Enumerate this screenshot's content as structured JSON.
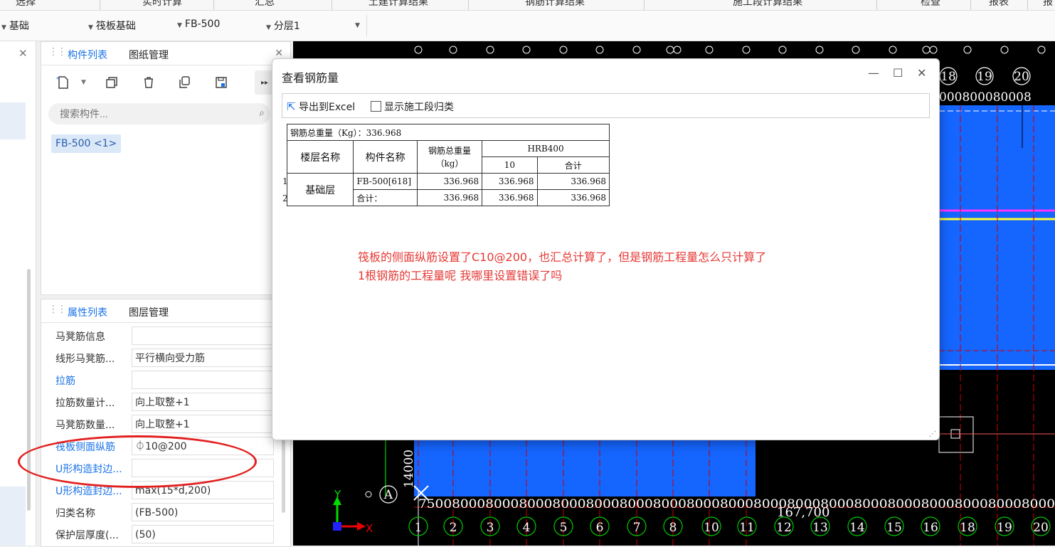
{
  "ribbon": {
    "items": [
      "选择",
      "实时计算",
      "汇总",
      "土建计算结果",
      "钢筋计算结果",
      "施工段计算结果",
      "检查",
      "报表",
      "报"
    ]
  },
  "selectors": {
    "s1": "基础",
    "s2": "筏板基础",
    "s3": "FB-500",
    "s4": "分层1"
  },
  "panel1": {
    "tab_active": "构件列表",
    "tab_other": "图纸管理",
    "search_placeholder": "搜索构件...",
    "component_item": "FB-500 <1>"
  },
  "panel2": {
    "tab_active": "属性列表",
    "tab_other": "图层管理",
    "rows": [
      {
        "key": "马凳筋信息",
        "value": ""
      },
      {
        "key": "线形马凳筋...",
        "value": "平行横向受力筋"
      },
      {
        "key": "拉筋",
        "value": ""
      },
      {
        "key": "拉筋数量计...",
        "value": "向上取整+1"
      },
      {
        "key": "马凳筋数量...",
        "value": "向上取整+1"
      },
      {
        "key": "筏板侧面纵筋",
        "value": "⏀10@200"
      },
      {
        "key": "U形构造封边...",
        "value": ""
      },
      {
        "key": "U形构造封边...",
        "value": "max(15*d,200)"
      },
      {
        "key": "归类名称",
        "value": "(FB-500)"
      },
      {
        "key": "保护层厚度(...",
        "value": "(50)"
      }
    ]
  },
  "dialog": {
    "title": "查看钢筋量",
    "export_label": "导出到Excel",
    "checkbox_label": "显示施工段归类",
    "table": {
      "total_label": "钢筋总重量（Kg）：336.968",
      "h_floor": "楼层名称",
      "h_component": "构件名称",
      "h_total_weight": "钢筋总重量（kg）",
      "h_grade": "HRB400",
      "h_dia": "10",
      "h_sum": "合计",
      "row_nums": [
        "1",
        "2"
      ],
      "floor": "基础层",
      "rows": [
        {
          "name": "FB-500[618]",
          "total": "336.968",
          "d10": "336.968",
          "sum": "336.968"
        },
        {
          "name": "合计：",
          "total": "336.968",
          "d10": "336.968",
          "sum": "336.968"
        }
      ]
    },
    "note_line1": "筏板的侧面纵筋设置了C10@200，也汇总计算了，但是钢筋工程量怎么只计算了",
    "note_line2": "1根钢筋的工程量呢   我哪里设置错误了吗"
  },
  "cad": {
    "top_axis_labels": [
      "18",
      "19",
      "20"
    ],
    "top_dims": "000800080008",
    "bottom_dims": "7500800080008000800080008000800080008000800080008000800080008000800080008000",
    "bottom_total": "167,700",
    "vertical_dim": "14000",
    "axis_numbers": [
      "1",
      "2",
      "3",
      "4",
      "5",
      "6",
      "7",
      "8",
      "10",
      "11",
      "12",
      "13",
      "14",
      "15",
      "16",
      "18",
      "19",
      "20"
    ],
    "axis_a": "A",
    "ucs_y": "Y",
    "ucs_x": "X"
  },
  "colors": {
    "accent": "#1a73e8",
    "annotation": "#e53935",
    "cad_blue": "#1565ff",
    "cad_bg": "#000000"
  }
}
